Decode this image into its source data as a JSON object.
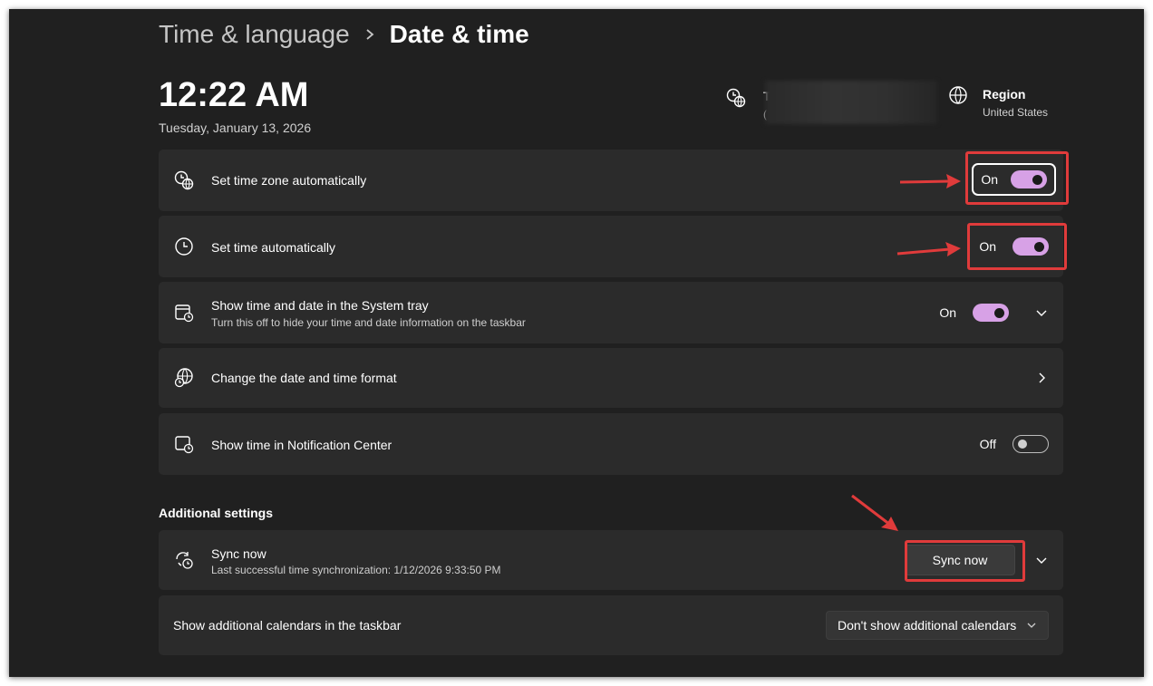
{
  "breadcrumb": {
    "parent": "Time & language",
    "current": "Date & time"
  },
  "clock": {
    "time": "12:22 AM",
    "date": "Tuesday, January 13, 2026"
  },
  "header_tiles": {
    "timezone": {
      "title": "T",
      "subtitle": "(",
      "icon": "timezone-globe-icon"
    },
    "region": {
      "title": "Region",
      "value": "United States",
      "icon": "globe-icon"
    }
  },
  "settings": [
    {
      "title": "Set time zone automatically",
      "state": "On",
      "icon": "timezone-globe-icon"
    },
    {
      "title": "Set time automatically",
      "state": "On",
      "icon": "clock-icon"
    },
    {
      "title": "Show time and date in the System tray",
      "description": "Turn this off to hide your time and date information on the taskbar",
      "state": "On",
      "icon": "calendar-clock-icon"
    },
    {
      "title": "Change the date and time format",
      "icon": "globe-clock-icon"
    },
    {
      "title": "Show time in Notification Center",
      "state": "Off",
      "icon": "notification-clock-icon"
    }
  ],
  "additional": {
    "heading": "Additional settings",
    "sync": {
      "title": "Sync now",
      "description": "Last successful time synchronization: 1/12/2026 9:33:50 PM",
      "button": "Sync now",
      "icon": "sync-clock-icon"
    },
    "calendars": {
      "title": "Show additional calendars in the taskbar",
      "selected": "Don't show additional calendars"
    }
  },
  "colors": {
    "window_bg": "#202020",
    "card_bg": "#2b2b2b",
    "accent_toggle": "#d7a1e6",
    "annotation_red": "#e03b3b"
  }
}
